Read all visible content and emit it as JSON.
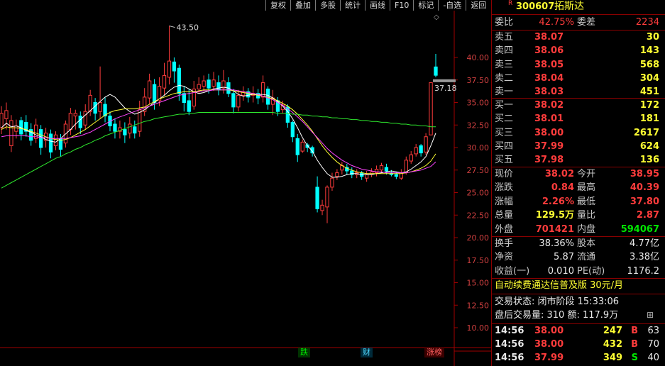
{
  "toolbar": [
    "复权",
    "叠加",
    "多股",
    "统计",
    "画线",
    "F10",
    "标记",
    "-自选",
    "返回"
  ],
  "chart_data": {
    "type": "candlestick",
    "y_ticks": [
      "40.00",
      "37.50",
      "35.00",
      "32.50",
      "30.00",
      "27.50",
      "25.00",
      "22.50",
      "20.00",
      "17.50",
      "15.00",
      "12.50",
      "10.00"
    ],
    "ylim": [
      10,
      40
    ],
    "candles": [
      [
        32.2,
        33.8,
        31.5,
        34.6
      ],
      [
        33.2,
        34.1,
        32.0,
        35.0
      ],
      [
        30.2,
        33.0,
        29.5,
        33.6
      ],
      [
        31.8,
        32.4,
        31.0,
        33.1
      ],
      [
        33.0,
        31.5,
        30.8,
        33.4
      ],
      [
        32.8,
        31.8,
        31.2,
        33.6
      ],
      [
        32.0,
        30.8,
        30.2,
        32.7
      ],
      [
        31.0,
        32.5,
        30.5,
        33.2
      ],
      [
        32.0,
        30.0,
        29.2,
        32.5
      ],
      [
        30.8,
        31.6,
        30.0,
        32.2
      ],
      [
        31.5,
        29.5,
        28.8,
        32.0
      ],
      [
        30.2,
        31.4,
        29.7,
        31.8
      ],
      [
        31.0,
        29.8,
        29.0,
        31.5
      ],
      [
        30.5,
        32.6,
        30.0,
        33.0
      ],
      [
        32.0,
        33.8,
        31.4,
        34.4
      ],
      [
        33.5,
        33.8,
        32.0,
        34.2
      ],
      [
        33.5,
        32.2,
        31.5,
        34.0
      ],
      [
        32.5,
        34.0,
        32.0,
        34.8
      ],
      [
        34.0,
        35.8,
        33.5,
        36.4
      ],
      [
        35.0,
        33.8,
        33.0,
        35.5
      ],
      [
        34.0,
        35.0,
        33.2,
        39.0
      ],
      [
        34.8,
        33.5,
        32.8,
        35.6
      ],
      [
        33.5,
        32.4,
        31.8,
        34.0
      ],
      [
        32.6,
        31.8,
        31.0,
        33.2
      ],
      [
        31.8,
        32.2,
        31.0,
        33.0
      ],
      [
        32.0,
        31.4,
        30.5,
        32.8
      ],
      [
        31.6,
        32.6,
        31.0,
        33.4
      ],
      [
        32.3,
        31.6,
        31.0,
        33.0
      ],
      [
        31.8,
        34.2,
        31.2,
        35.2
      ],
      [
        34.0,
        35.6,
        33.5,
        36.6
      ],
      [
        35.5,
        37.4,
        34.8,
        38.2
      ],
      [
        37.0,
        35.0,
        34.2,
        37.6
      ],
      [
        35.2,
        36.8,
        34.6,
        37.8
      ],
      [
        36.6,
        38.0,
        35.8,
        39.4
      ],
      [
        37.8,
        39.6,
        37.0,
        43.5
      ],
      [
        39.5,
        38.5,
        37.2,
        40.0
      ],
      [
        38.8,
        36.0,
        35.2,
        39.2
      ],
      [
        36.0,
        35.0,
        34.0,
        36.8
      ],
      [
        35.2,
        34.0,
        33.6,
        36.5
      ],
      [
        34.6,
        36.5,
        34.2,
        37.4
      ],
      [
        36.5,
        37.0,
        36.0,
        37.8
      ],
      [
        36.8,
        37.4,
        36.2,
        38.0
      ],
      [
        37.5,
        36.6,
        36.0,
        38.2
      ],
      [
        36.8,
        37.5,
        36.3,
        38.4
      ],
      [
        37.2,
        36.4,
        35.8,
        38.0
      ],
      [
        36.6,
        37.4,
        36.0,
        38.6
      ],
      [
        37.2,
        36.0,
        35.6,
        37.8
      ],
      [
        36.0,
        34.5,
        33.8,
        36.5
      ],
      [
        34.5,
        35.8,
        34.0,
        36.4
      ],
      [
        35.8,
        36.2,
        35.2,
        36.8
      ],
      [
        36.2,
        35.6,
        35.0,
        36.6
      ],
      [
        35.8,
        36.0,
        35.0,
        36.8
      ],
      [
        36.0,
        35.5,
        34.8,
        36.5
      ],
      [
        35.6,
        37.2,
        35.0,
        38.0
      ],
      [
        36.5,
        34.8,
        34.2,
        36.8
      ],
      [
        34.8,
        35.5,
        33.6,
        36.4
      ],
      [
        35.2,
        34.0,
        33.5,
        35.6
      ],
      [
        34.2,
        34.8,
        33.8,
        35.2
      ],
      [
        34.5,
        32.8,
        32.2,
        34.8
      ],
      [
        32.8,
        31.2,
        30.6,
        33.0
      ],
      [
        31.0,
        29.2,
        28.4,
        31.5
      ],
      [
        29.6,
        30.6,
        29.4,
        30.9
      ],
      [
        30.3,
        30.0,
        29.5,
        30.5
      ],
      [
        30.0,
        29.4,
        29.0,
        30.2
      ],
      [
        25.6,
        23.2,
        22.8,
        26.8
      ],
      [
        23.0,
        23.6,
        22.5,
        24.2
      ],
      [
        23.4,
        25.6,
        21.6,
        25.8
      ],
      [
        25.6,
        26.6,
        25.2,
        27.2
      ],
      [
        26.8,
        27.2,
        26.4,
        27.6
      ],
      [
        27.5,
        28.0,
        27.0,
        28.4
      ],
      [
        27.8,
        27.4,
        27.0,
        28.2
      ],
      [
        27.4,
        27.0,
        26.6,
        27.8
      ],
      [
        27.0,
        27.2,
        26.6,
        27.6
      ],
      [
        27.2,
        26.8,
        26.4,
        27.4
      ],
      [
        26.6,
        27.0,
        26.2,
        27.4
      ],
      [
        27.0,
        27.3,
        26.7,
        27.7
      ],
      [
        27.2,
        27.6,
        26.8,
        28.0
      ],
      [
        27.5,
        28.0,
        27.2,
        28.3
      ],
      [
        27.8,
        27.4,
        27.0,
        28.2
      ],
      [
        27.2,
        27.0,
        26.8,
        27.5
      ],
      [
        27.0,
        26.8,
        26.5,
        27.3
      ],
      [
        26.6,
        27.2,
        26.4,
        27.6
      ],
      [
        27.2,
        28.6,
        27.0,
        29.0
      ],
      [
        28.5,
        29.2,
        28.2,
        29.6
      ],
      [
        29.3,
        30.0,
        29.0,
        30.4
      ],
      [
        30.2,
        29.4,
        29.0,
        30.4
      ],
      [
        29.5,
        31.2,
        29.2,
        31.6
      ],
      [
        31.4,
        37.2,
        31.4,
        37.2
      ],
      [
        38.95,
        38.02,
        37.8,
        40.39
      ]
    ],
    "ma_series": [
      {
        "color": "#ffffff",
        "values": [
          32.2,
          32.7,
          32.3,
          32.4,
          32.2,
          31.9,
          31.7,
          31.4,
          31.2,
          30.9,
          30.7,
          30.6,
          31.0,
          31.5,
          32.0,
          32.6,
          33.1,
          33.6,
          34.1,
          34.6,
          35.1,
          35.6,
          35.9,
          35.6,
          35.0,
          34.4,
          34.0,
          33.7,
          33.9,
          34.2,
          34.6,
          35.0,
          35.4,
          35.8,
          36.3,
          36.7,
          36.9,
          36.8,
          36.5,
          36.2,
          36.0,
          36.1,
          36.3,
          36.5,
          36.6,
          36.7,
          36.6,
          36.3,
          35.9,
          35.7,
          35.8,
          35.9,
          35.9,
          35.9,
          35.8,
          35.5,
          35.1,
          34.6,
          34.0,
          33.2,
          32.2,
          31.1,
          30.2,
          29.6,
          28.6,
          27.8,
          27.1,
          26.7,
          26.7,
          26.8,
          27.0,
          27.1,
          27.1,
          27.0,
          27.0,
          27.0,
          27.1,
          27.2,
          27.3,
          27.4,
          27.3,
          27.2,
          27.3,
          27.6,
          28.0,
          28.4,
          29.0,
          30.2,
          31.6
        ]
      },
      {
        "color": "#ffff33",
        "values": [
          32.0,
          32.3,
          32.2,
          32.2,
          32.1,
          32.0,
          31.8,
          31.6,
          31.4,
          31.2,
          31.0,
          30.9,
          30.8,
          30.9,
          31.1,
          31.4,
          31.7,
          32.0,
          32.4,
          32.8,
          33.2,
          33.6,
          33.9,
          34.1,
          34.2,
          34.3,
          34.3,
          34.3,
          34.4,
          34.5,
          34.8,
          35.1,
          35.4,
          35.6,
          35.8,
          36.0,
          36.1,
          36.2,
          36.2,
          36.2,
          36.3,
          36.4,
          36.4,
          36.4,
          36.4,
          36.4,
          36.4,
          36.3,
          36.2,
          36.1,
          36.0,
          35.9,
          35.8,
          35.7,
          35.6,
          35.4,
          35.2,
          34.9,
          34.6,
          34.2,
          33.7,
          33.1,
          32.5,
          31.8,
          31.0,
          30.2,
          29.5,
          28.9,
          28.4,
          28.0,
          27.7,
          27.5,
          27.3,
          27.2,
          27.1,
          27.1,
          27.1,
          27.1,
          27.1,
          27.1,
          27.1,
          27.1,
          27.2,
          27.3,
          27.5,
          27.7,
          28.0,
          28.5,
          29.3
        ]
      },
      {
        "color": "#ff44ff",
        "values": [
          31.2,
          31.3,
          31.3,
          31.3,
          31.3,
          31.3,
          31.2,
          31.2,
          31.1,
          31.1,
          31.0,
          31.0,
          31.0,
          31.0,
          31.1,
          31.2,
          31.3,
          31.5,
          31.7,
          32.0,
          32.3,
          32.6,
          32.9,
          33.2,
          33.4,
          33.6,
          33.8,
          34.0,
          34.2,
          34.4,
          34.6,
          34.8,
          35.0,
          35.2,
          35.4,
          35.6,
          35.8,
          35.9,
          36.0,
          36.1,
          36.2,
          36.3,
          36.3,
          36.4,
          36.4,
          36.4,
          36.4,
          36.4,
          36.3,
          36.2,
          36.1,
          36.0,
          35.9,
          35.7,
          35.5,
          35.3,
          35.0,
          34.7,
          34.3,
          33.9,
          33.4,
          32.9,
          32.3,
          31.7,
          31.1,
          30.5,
          29.9,
          29.4,
          29.0,
          28.6,
          28.3,
          28.0,
          27.8,
          27.6,
          27.5,
          27.4,
          27.3,
          27.3,
          27.2,
          27.2,
          27.2,
          27.2,
          27.2,
          27.3,
          27.4,
          27.5,
          27.7,
          27.9,
          28.4
        ]
      },
      {
        "color": "#2ee82e",
        "values": [
          25.5,
          25.8,
          26.1,
          26.4,
          26.7,
          27.0,
          27.3,
          27.6,
          27.9,
          28.2,
          28.5,
          28.8,
          29.0,
          29.3,
          29.5,
          29.8,
          30.0,
          30.3,
          30.5,
          30.8,
          31.0,
          31.3,
          31.5,
          31.7,
          31.9,
          32.1,
          32.3,
          32.5,
          32.7,
          32.9,
          33.0,
          33.2,
          33.3,
          33.4,
          33.5,
          33.6,
          33.7,
          33.7,
          33.8,
          33.8,
          33.9,
          33.9,
          33.9,
          33.9,
          33.9,
          33.9,
          33.9,
          33.9,
          33.9,
          33.9,
          33.9,
          33.9,
          33.9,
          33.9,
          33.9,
          33.9,
          33.8,
          33.8,
          33.8,
          33.7,
          33.7,
          33.6,
          33.6,
          33.5,
          33.5,
          33.4,
          33.4,
          33.3,
          33.3,
          33.2,
          33.2,
          33.1,
          33.1,
          33.0,
          33.0,
          32.9,
          32.9,
          32.8,
          32.8,
          32.7,
          32.7,
          32.6,
          32.6,
          32.5,
          32.5,
          32.4,
          32.4,
          32.3,
          32.3
        ]
      }
    ],
    "annotations": [
      {
        "text": "43.50",
        "candle_index": 34,
        "price": 43.5
      },
      {
        "text": "37.18",
        "candle_index": 87,
        "price": 37.18
      }
    ]
  },
  "flags": [
    {
      "text": "跌",
      "color": "#00e600",
      "bg": "#003300"
    },
    {
      "text": "财",
      "color": "#4fd8ff",
      "bg": "#002a3a"
    },
    {
      "text": "涨榜",
      "color": "#ff6060",
      "bg": "#3a0000"
    }
  ],
  "panel": {
    "marker": "R",
    "code": "300607",
    "name": "拓斯达",
    "wei_bi_label": "委比",
    "wei_bi": "42.75%",
    "wei_cha_label": "委差",
    "wei_cha": "2234",
    "asks": [
      {
        "label": "卖五",
        "price": "38.07",
        "vol": "30"
      },
      {
        "label": "卖四",
        "price": "38.06",
        "vol": "143"
      },
      {
        "label": "卖三",
        "price": "38.05",
        "vol": "568"
      },
      {
        "label": "卖二",
        "price": "38.04",
        "vol": "304"
      },
      {
        "label": "卖一",
        "price": "38.03",
        "vol": "451"
      }
    ],
    "bids": [
      {
        "label": "买一",
        "price": "38.02",
        "vol": "172"
      },
      {
        "label": "买二",
        "price": "38.01",
        "vol": "181"
      },
      {
        "label": "买三",
        "price": "38.00",
        "vol": "2617"
      },
      {
        "label": "买四",
        "price": "37.99",
        "vol": "624"
      },
      {
        "label": "买五",
        "price": "37.98",
        "vol": "136"
      }
    ],
    "stats": [
      {
        "l1": "现价",
        "v1": "38.02",
        "c1": "red",
        "l2": "今开",
        "v2": "38.95",
        "c2": "red"
      },
      {
        "l1": "涨跌",
        "v1": "0.84",
        "c1": "red",
        "l2": "最高",
        "v2": "40.39",
        "c2": "red"
      },
      {
        "l1": "涨幅",
        "v1": "2.26%",
        "c1": "red",
        "l2": "最低",
        "v2": "37.80",
        "c2": "red"
      },
      {
        "l1": "总量",
        "v1": "129.5万",
        "c1": "yellow",
        "l2": "量比",
        "v2": "2.87",
        "c2": "red"
      },
      {
        "l1": "外盘",
        "v1": "701421",
        "c1": "red",
        "l2": "内盘",
        "v2": "594067",
        "c2": "green"
      }
    ],
    "info": [
      {
        "l1": "换手",
        "v1": "38.36%",
        "l2": "股本",
        "v2": "4.77亿"
      },
      {
        "l1": "净资",
        "v1": "5.87",
        "l2": "流通",
        "v2": "3.38亿"
      },
      {
        "l1": "收益(一)",
        "v1": "0.010",
        "l2": "PE(动)",
        "v2": "1176.2"
      }
    ],
    "banner": "自动续费通达信普及版  30元/月",
    "trade_status": "交易状态: 闭市阶段 15:33:06",
    "after_hours": "盘后交易量: 310  额: 117.9万",
    "ticks": [
      {
        "time": "14:56",
        "price": "38.00",
        "vol": "247",
        "side": "B",
        "n": "63"
      },
      {
        "time": "14:56",
        "price": "38.00",
        "vol": "432",
        "side": "B",
        "n": "70"
      },
      {
        "time": "14:56",
        "price": "37.99",
        "vol": "349",
        "side": "S",
        "n": "40"
      }
    ]
  }
}
